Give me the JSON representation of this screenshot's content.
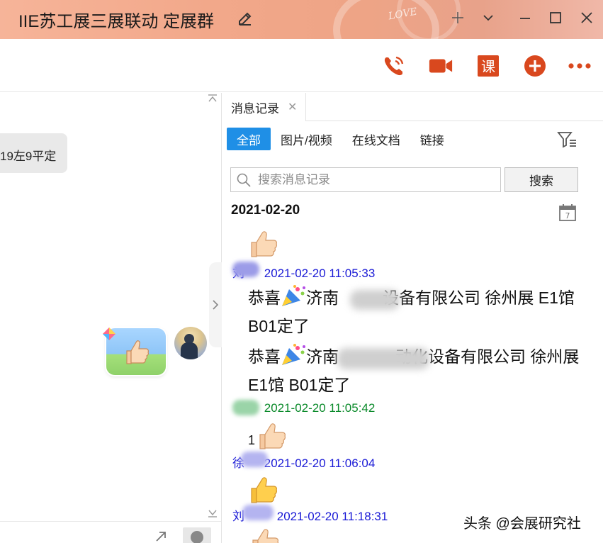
{
  "window": {
    "title": "IIE苏工展三展联动 定展群"
  },
  "chat": {
    "partial_message": "19左9平定"
  },
  "history_panel": {
    "tab_label": "消息记录",
    "filters": [
      {
        "label": "全部",
        "active": true
      },
      {
        "label": "图片/视频",
        "active": false
      },
      {
        "label": "在线文档",
        "active": false
      },
      {
        "label": "链接",
        "active": false
      }
    ],
    "search": {
      "placeholder": "搜索消息记录",
      "button_label": "搜索"
    },
    "date_header": "2021-02-20",
    "calendar_day": "7",
    "messages": [
      {
        "sender_visible": "刘",
        "timestamp": "2021-02-20 11:05:33",
        "name_color": "#1a1ad6",
        "lines": [
          {
            "before": "恭喜",
            "after": "济南",
            "rest": "设备有限公司  徐州展  E1馆  B01定了"
          },
          {
            "before": "恭喜",
            "after": "济南",
            "rest": "动化设备有限公司  徐州展  E1馆  B01定了"
          }
        ]
      },
      {
        "sender_visible": "",
        "timestamp": "2021-02-20 11:05:42",
        "name_color": "#0a8a2a",
        "text": "1"
      },
      {
        "sender_visible": "徐",
        "timestamp": "2021-02-20 11:06:04",
        "name_color": "#1a1ad6"
      },
      {
        "sender_visible": "刘",
        "timestamp": "2021-02-20 11:18:31",
        "name_color": "#1a1ad6"
      }
    ]
  },
  "watermark": "头条 @会展研究社",
  "colors": {
    "accent": "#1f8fe6",
    "toolbar_icon": "#d9481e"
  },
  "icons": {
    "toolbar": [
      "phone-call-icon",
      "video-call-icon",
      "course-icon",
      "add-icon",
      "more-icon"
    ]
  }
}
